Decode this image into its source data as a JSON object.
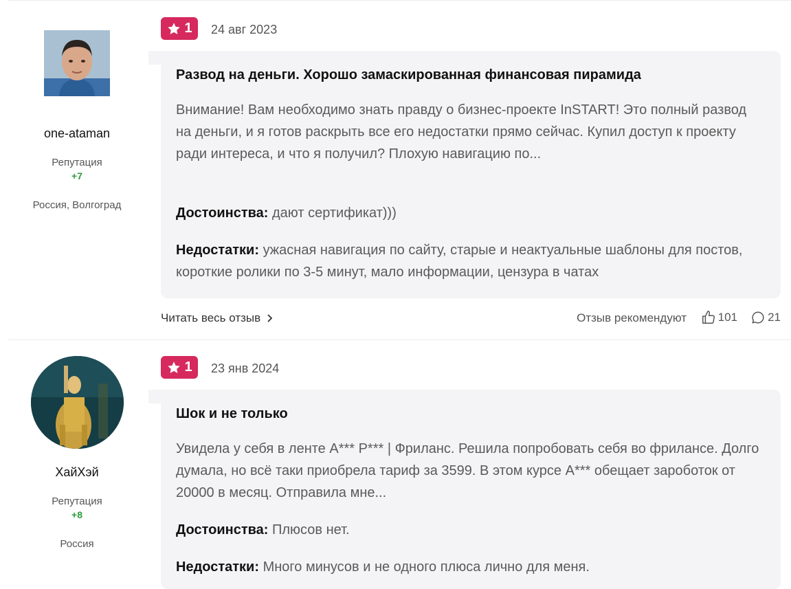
{
  "reviews": [
    {
      "author": {
        "name": "one-ataman",
        "reputation_label": "Репутация",
        "reputation_value": "+7",
        "location": "Россия, Волгоград",
        "avatar": "male-photo-avatar"
      },
      "rating": "1",
      "date": "24 авг 2023",
      "title": "Развод на деньги. Хорошо замаскированная финансовая пирамида",
      "text": "Внимание! Вам необходимо знать правду о бизнес-проекте InSTART! Это полный развод на деньги, и я готов раскрыть все его недостатки прямо сейчас. Купил доступ к проекту ради интереса, и что я получил? Плохую навигацию по...",
      "pros_label": "Достоинства:",
      "pros": "дают сертификат)))",
      "cons_label": "Недостатки:",
      "cons": "ужасная навигация по сайту, старые и неактуальные шаблоны для постов, короткие ролики по 3-5 минут, мало информации, цензура в чатах",
      "read_more": "Читать весь отзыв",
      "recommend_label": "Отзыв рекомендуют",
      "likes": "101",
      "comments": "21"
    },
    {
      "author": {
        "name": "ХайХэй",
        "reputation_label": "Репутация",
        "reputation_value": "+8",
        "location": "Россия",
        "avatar": "game-character-avatar"
      },
      "rating": "1",
      "date": "23 янв 2024",
      "title": "Шок и не только",
      "text": "Увидела у себя в ленте А*** Р*** | Фриланс. Решила попробовать себя во фрилансе. Долго думала, но всё таки приобрела тариф за 3599. В этом курсе А*** обещает зароботок от 20000 в месяц. Отправила мне...",
      "pros_label": "Достоинства:",
      "pros": "Плюсов нет.",
      "cons_label": "Недостатки:",
      "cons": "Много минусов и не одного плюса лично для меня."
    }
  ],
  "icons": {
    "rating": "star-icon",
    "read_more": "chevron-right-icon",
    "like": "thumbs-up-icon",
    "comment": "comment-icon"
  },
  "colors": {
    "badge": "#d6295d",
    "reputation": "#2e9e3c",
    "card_bg": "#f4f4f6"
  }
}
